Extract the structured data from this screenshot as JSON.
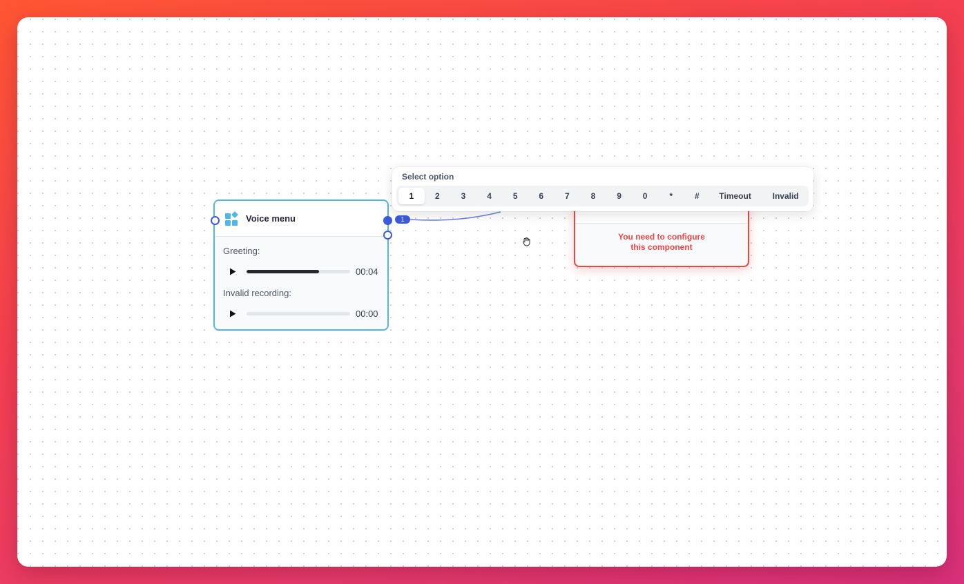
{
  "voice_menu": {
    "title": "Voice menu",
    "icon": "widgets-icon",
    "greeting": {
      "label": "Greeting:",
      "time": "00:04",
      "progress_fraction": 0.7
    },
    "invalid_recording": {
      "label": "Invalid recording:",
      "time": "00:00",
      "progress_fraction": 0
    }
  },
  "edge": {
    "badge": "1",
    "color": "#3b5bdb"
  },
  "option_popover": {
    "title": "Select option",
    "options": [
      "1",
      "2",
      "3",
      "4",
      "5",
      "6",
      "7",
      "8",
      "9",
      "0",
      "*",
      "#",
      "Timeout",
      "Invalid"
    ],
    "selected": "1"
  },
  "unconfigured_node": {
    "message": "You need to configure this component",
    "color": "#ef4444"
  },
  "colors": {
    "node_border": "#4fb6ec",
    "accent": "#3b5bdb"
  }
}
